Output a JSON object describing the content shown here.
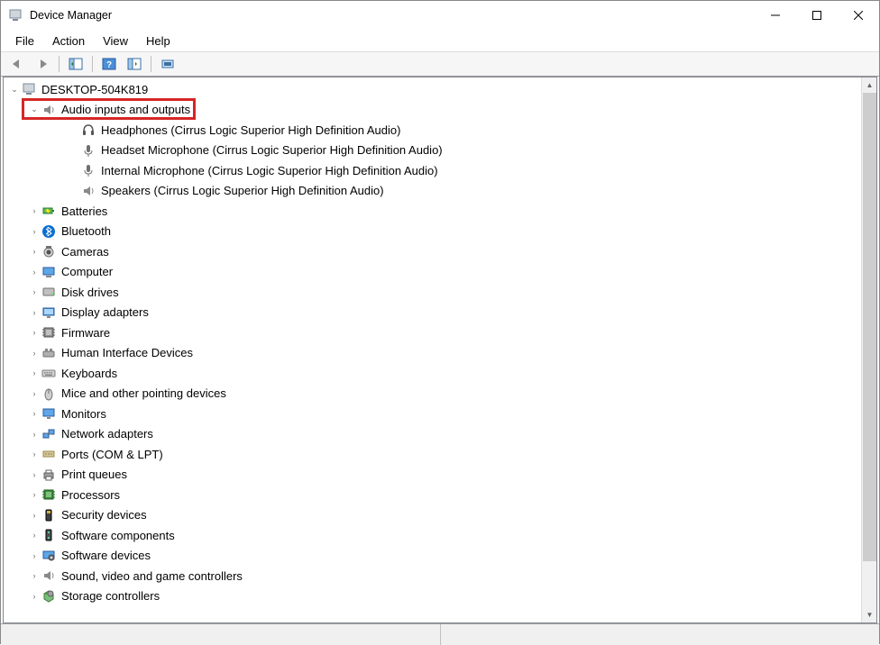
{
  "window": {
    "title": "Device Manager"
  },
  "menu": {
    "file": "File",
    "action": "Action",
    "view": "View",
    "help": "Help"
  },
  "toolbar": {
    "back": "Back",
    "forward": "Forward",
    "show_hide_tree": "Show/Hide Console Tree",
    "help": "Help",
    "properties": "Properties",
    "scan": "Scan for hardware changes"
  },
  "tree": {
    "root": "DESKTOP-504K819",
    "categories": [
      {
        "label": "Audio inputs and outputs",
        "icon": "speaker-icon",
        "expanded": true,
        "highlighted": true,
        "children": [
          {
            "label": "Headphones (Cirrus Logic Superior High Definition Audio)",
            "icon": "headphones-icon"
          },
          {
            "label": "Headset Microphone (Cirrus Logic Superior High Definition Audio)",
            "icon": "microphone-icon"
          },
          {
            "label": "Internal Microphone (Cirrus Logic Superior High Definition Audio)",
            "icon": "microphone-icon"
          },
          {
            "label": "Speakers (Cirrus Logic Superior High Definition Audio)",
            "icon": "speaker-icon"
          }
        ]
      },
      {
        "label": "Batteries",
        "icon": "battery-icon"
      },
      {
        "label": "Bluetooth",
        "icon": "bluetooth-icon"
      },
      {
        "label": "Cameras",
        "icon": "camera-icon"
      },
      {
        "label": "Computer",
        "icon": "computer-icon"
      },
      {
        "label": "Disk drives",
        "icon": "disk-icon"
      },
      {
        "label": "Display adapters",
        "icon": "display-icon"
      },
      {
        "label": "Firmware",
        "icon": "firmware-icon"
      },
      {
        "label": "Human Interface Devices",
        "icon": "hid-icon"
      },
      {
        "label": "Keyboards",
        "icon": "keyboard-icon"
      },
      {
        "label": "Mice and other pointing devices",
        "icon": "mouse-icon"
      },
      {
        "label": "Monitors",
        "icon": "monitor-icon"
      },
      {
        "label": "Network adapters",
        "icon": "network-icon"
      },
      {
        "label": "Ports (COM & LPT)",
        "icon": "port-icon"
      },
      {
        "label": "Print queues",
        "icon": "printer-icon"
      },
      {
        "label": "Processors",
        "icon": "processor-icon"
      },
      {
        "label": "Security devices",
        "icon": "security-icon"
      },
      {
        "label": "Software components",
        "icon": "software-component-icon"
      },
      {
        "label": "Software devices",
        "icon": "software-device-icon"
      },
      {
        "label": "Sound, video and game controllers",
        "icon": "sound-icon"
      },
      {
        "label": "Storage controllers",
        "icon": "storage-icon"
      }
    ]
  }
}
